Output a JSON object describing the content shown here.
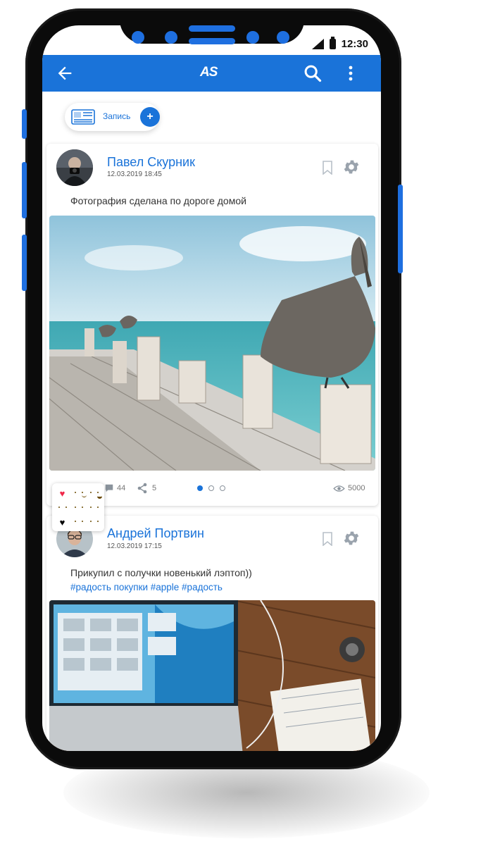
{
  "status_bar": {
    "time": "12:30"
  },
  "app_bar": {
    "logo": "AS"
  },
  "compose": {
    "label": "Запись",
    "plus": "+"
  },
  "posts": [
    {
      "author": "Павел Скурник",
      "date": "12.03.2019  18:45",
      "text": "Фотография сделана по дороге домой",
      "comments": "44",
      "shares": "5",
      "views": "5000",
      "carousel_active_index": 0,
      "carousel_total": 3
    },
    {
      "author": "Андрей Портвин",
      "date": "12.03.2019  17:15",
      "text": "Прикупил с получки новенький лэптоп))",
      "tags": "#радость покупки #apple #радость"
    }
  ],
  "colors": {
    "accent": "#1a73d9",
    "side_buttons": "#1e6fe0",
    "heart": "#f0284a",
    "emoji": "#f7c61c"
  },
  "icons": [
    "back-arrow-icon",
    "search-icon",
    "more-vert-icon",
    "newspaper-icon",
    "plus-icon",
    "bookmark-icon",
    "gear-icon",
    "comment-icon",
    "share-icon",
    "eye-icon",
    "heart-icon"
  ]
}
